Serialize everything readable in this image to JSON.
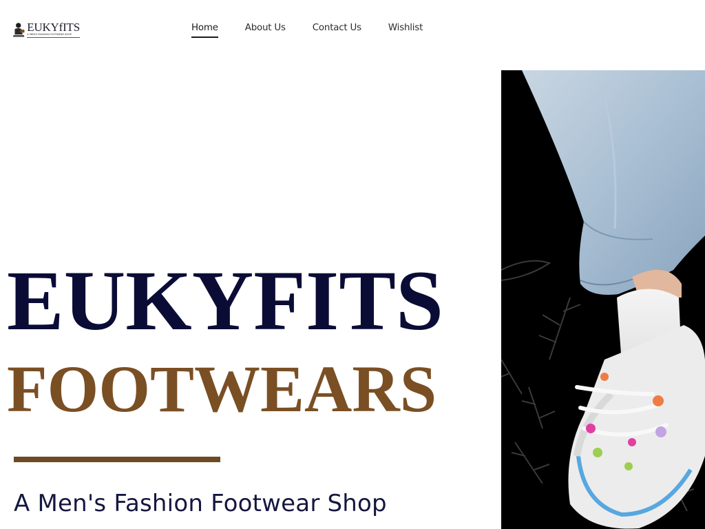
{
  "brand": {
    "logo_text": "EUKYfITS",
    "logo_tagline": "A MEN'S FASHION FOOTWEAR SHOP"
  },
  "nav": {
    "items": [
      {
        "label": "Home",
        "active": true
      },
      {
        "label": "About Us",
        "active": false
      },
      {
        "label": "Contact Us",
        "active": false
      },
      {
        "label": "Wishlist",
        "active": false
      }
    ]
  },
  "hero": {
    "title_line_1": "EUKYFITS",
    "title_line_2": "FOOTWEARS",
    "subtitle": "A Men's Fashion Footwear Shop",
    "colors": {
      "title_line_1": "#0b0c36",
      "title_line_2": "#7a4f24",
      "divider": "#6e4a23",
      "image_background": "#000000"
    },
    "image": {
      "subject": "sneaker-with-denim-jeans"
    }
  }
}
